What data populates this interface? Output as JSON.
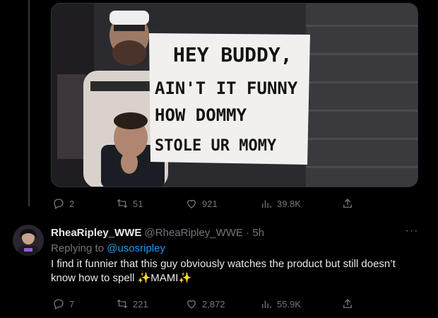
{
  "first_tweet": {
    "media": {
      "sign_lines": [
        "HEY BUDDY,",
        "AIN'T IT FUNNY",
        "HOW DOMMY",
        "STOLE UR MOMY"
      ]
    },
    "actions": {
      "replies": "2",
      "retweets": "51",
      "likes": "921",
      "views": "39.8K"
    }
  },
  "reply_tweet": {
    "display_name": "RheaRipley_WWE",
    "handle": "@RheaRipley_WWE",
    "separator": "·",
    "time": "5h",
    "replying_prefix": "Replying to",
    "replying_to": "@usosripley",
    "text_line1": "I find it funnier that this guy obviously watches the product but still doesn’t",
    "text_line2_start": "know how to spell ",
    "sparkle": "✨",
    "text_mami": "MAMI",
    "more": "···",
    "actions": {
      "replies": "7",
      "retweets": "221",
      "likes": "2,872",
      "views": "55.9K"
    }
  },
  "colors": {
    "background": "#000000",
    "text_primary": "#e7e9ea",
    "text_secondary": "#71767b",
    "link": "#1d9bf0",
    "border": "#2f3336"
  },
  "icons": {
    "reply": "reply-icon",
    "retweet": "retweet-icon",
    "like": "heart-icon",
    "views": "analytics-icon",
    "share": "share-icon"
  }
}
